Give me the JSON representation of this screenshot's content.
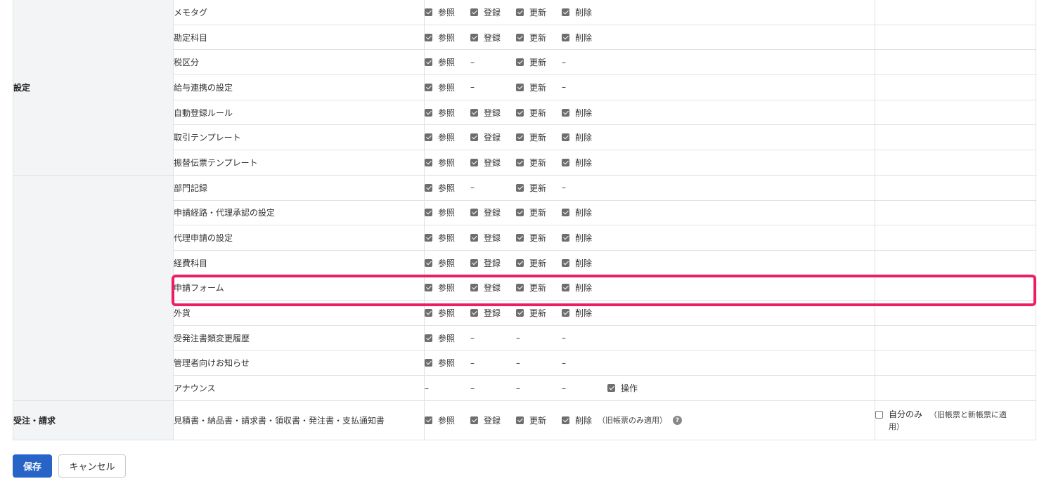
{
  "sections": [
    {
      "name": "設定",
      "rows": [
        {
          "feature": "メモタグ",
          "ref": "参照",
          "reg": "登録",
          "upd": "更新",
          "del": "削除"
        },
        {
          "feature": "勘定科目",
          "ref": "参照",
          "reg": "登録",
          "upd": "更新",
          "del": "削除"
        },
        {
          "feature": "税区分",
          "ref": "参照",
          "reg": "–",
          "upd": "更新",
          "del": "–"
        },
        {
          "feature": "給与連携の設定",
          "ref": "参照",
          "reg": "–",
          "upd": "更新",
          "del": "–"
        },
        {
          "feature": "自動登録ルール",
          "ref": "参照",
          "reg": "登録",
          "upd": "更新",
          "del": "削除"
        },
        {
          "feature": "取引テンプレート",
          "ref": "参照",
          "reg": "登録",
          "upd": "更新",
          "del": "削除"
        },
        {
          "feature": "振替伝票テンプレート",
          "ref": "参照",
          "reg": "登録",
          "upd": "更新",
          "del": "削除"
        },
        {
          "feature": "部門記録",
          "ref": "参照",
          "reg": "–",
          "upd": "更新",
          "del": "–"
        },
        {
          "feature": "申請経路・代理承認の設定",
          "ref": "参照",
          "reg": "登録",
          "upd": "更新",
          "del": "削除"
        },
        {
          "feature": "代理申請の設定",
          "ref": "参照",
          "reg": "登録",
          "upd": "更新",
          "del": "削除"
        },
        {
          "feature": "経費科目",
          "ref": "参照",
          "reg": "登録",
          "upd": "更新",
          "del": "削除"
        },
        {
          "feature": "申請フォーム",
          "ref": "参照",
          "reg": "登録",
          "upd": "更新",
          "del": "削除"
        },
        {
          "feature": "外貨",
          "ref": "参照",
          "reg": "登録",
          "upd": "更新",
          "del": "削除"
        },
        {
          "feature": "受発注書類変更履歴",
          "ref": "参照",
          "reg": "–",
          "upd": "–",
          "del": "–"
        },
        {
          "feature": "管理者向けお知らせ",
          "ref": "参照",
          "reg": "–",
          "upd": "–",
          "del": "–"
        },
        {
          "feature": "アナウンス",
          "ref": "–",
          "reg": "–",
          "upd": "–",
          "del": "–",
          "extra": "操作"
        }
      ]
    },
    {
      "name": "受注・請求",
      "rows": [
        {
          "feature": "見積書・納品書・請求書・領収書・発注書・支払通知書",
          "ref": "参照",
          "reg": "登録",
          "upd": "更新",
          "del": "削除",
          "note": "（旧帳票のみ適用）",
          "scope_label": "自分のみ",
          "scope_note": "（旧帳票と新帳票に適",
          "scope_note2": "用）"
        }
      ]
    }
  ],
  "buttons": {
    "save": "保存",
    "cancel": "キャンセル"
  },
  "colors": {
    "highlight": "#ee1c63",
    "primary": "#2864c8"
  }
}
